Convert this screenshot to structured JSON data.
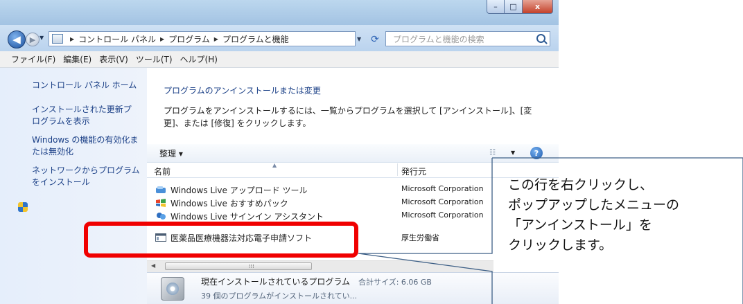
{
  "window": {
    "caption": {
      "minimize": "–",
      "maximize": "□",
      "close": "x"
    }
  },
  "nav": {
    "back": "◀",
    "forward": "▶",
    "breadcrumb": [
      "コントロール パネル",
      "プログラム",
      "プログラムと機能"
    ],
    "search_placeholder": "プログラムと機能の検索"
  },
  "menubar": [
    "ファイル(F)",
    "編集(E)",
    "表示(V)",
    "ツール(T)",
    "ヘルプ(H)"
  ],
  "sidebar": {
    "items": [
      {
        "label": "コントロール パネル ホーム"
      },
      {
        "label": "インストールされた更新プログラムを表示"
      },
      {
        "label": "Windows の機能の有効化または無効化"
      },
      {
        "label": "ネットワークからプログラムをインストール"
      }
    ]
  },
  "main": {
    "title": "プログラムのアンインストールまたは変更",
    "description": "プログラムをアンインストールするには、一覧からプログラムを選択して [アンインストール]、[変更]、または [修復] をクリックします。"
  },
  "toolbar": {
    "organize": "整理 ▾",
    "help": "?"
  },
  "columns": {
    "name": "名前",
    "publisher": "発行元"
  },
  "programs": [
    {
      "name": "Windows Live アップロード ツール",
      "publisher": "Microsoft Corporation",
      "icon": "upload-tool-icon",
      "color": "#4a90d9"
    },
    {
      "name": "Windows Live おすすめパック",
      "publisher": "Microsoft Corporation",
      "icon": "windows-live-icon",
      "color": "#3aa14a"
    },
    {
      "name": "Windows Live サインイン アシスタント",
      "publisher": "Microsoft Corporation",
      "icon": "signin-assistant-icon",
      "color": "#2f6fc1"
    },
    {
      "name": "医薬品医療機器法対応電子申請ソフト",
      "publisher": "厚生労働省",
      "icon": "application-window-icon",
      "color": "#4b5d73"
    }
  ],
  "details": {
    "title": "現在インストールされているプログラム",
    "size_label": "合計サイズ: 6.06 GB",
    "count_text": "39 個のプログラムがインストールされてい..."
  },
  "callout": {
    "lines": [
      "この行を右クリックし、",
      "ポップアップしたメニューの",
      "「アンインストール」を",
      "クリックします。"
    ],
    "highlight_color": "#f00000"
  }
}
